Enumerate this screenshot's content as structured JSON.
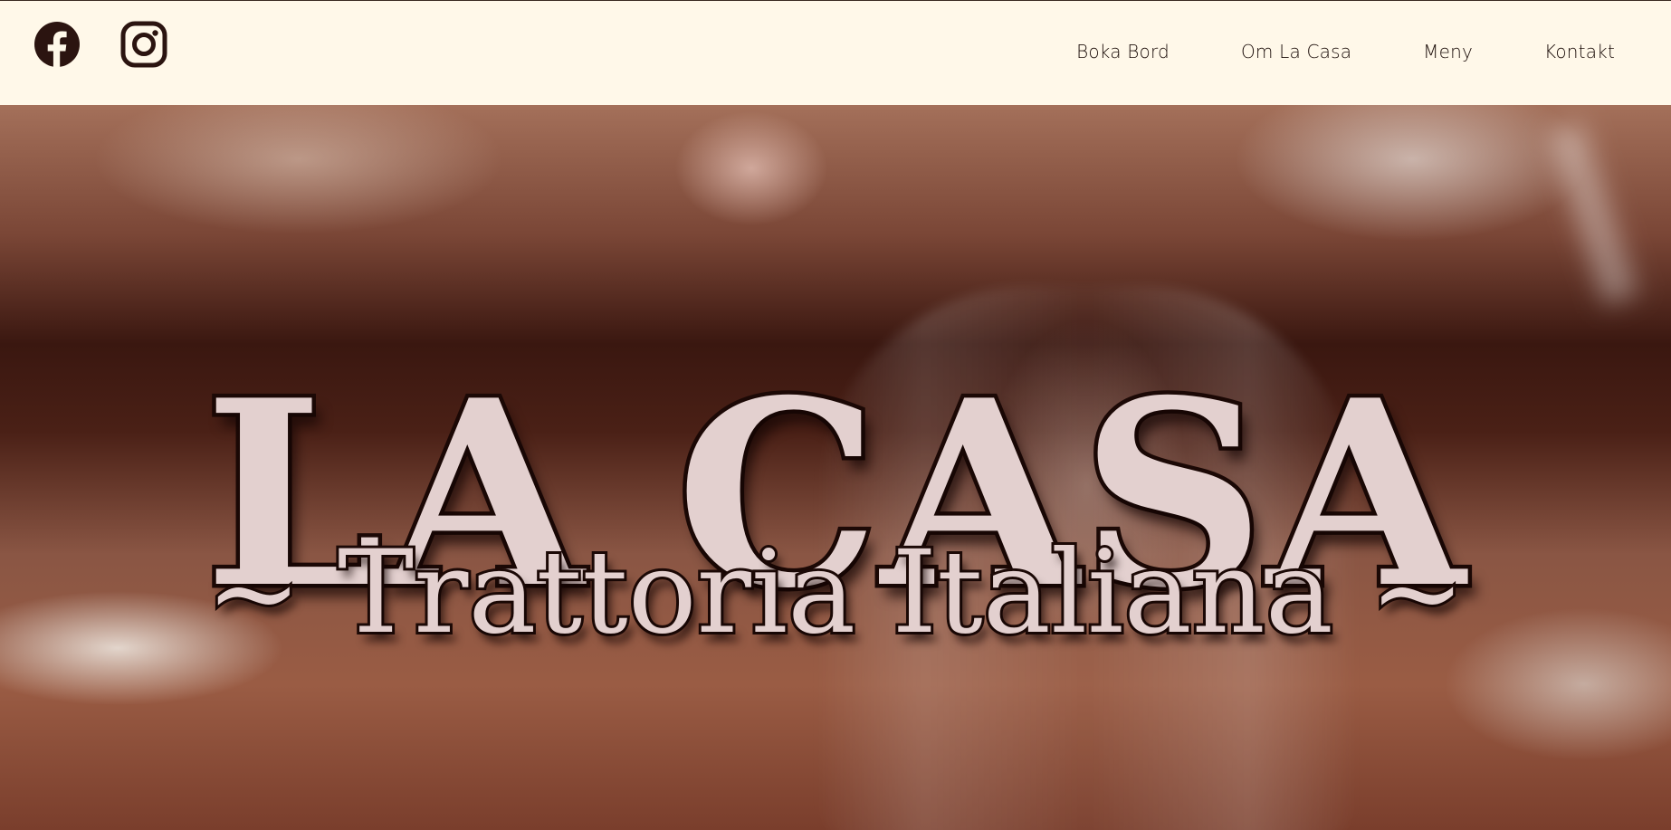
{
  "header": {
    "social": [
      {
        "icon": "facebook-icon",
        "label": "Facebook"
      },
      {
        "icon": "instagram-icon",
        "label": "Instagram"
      }
    ],
    "nav": [
      {
        "label": "Boka Bord"
      },
      {
        "label": "Om La Casa"
      },
      {
        "label": "Meny"
      },
      {
        "label": "Kontakt"
      }
    ]
  },
  "hero": {
    "title": "LA CASA",
    "subtitle": "~ Trattoria Italiana ~"
  },
  "colors": {
    "header_background": "#fff8e9",
    "icon_color": "#2b1410",
    "nav_text": "#1a0c08",
    "hero_text_fill": "#e3d0cf",
    "hero_text_outline": "#1c0906"
  }
}
